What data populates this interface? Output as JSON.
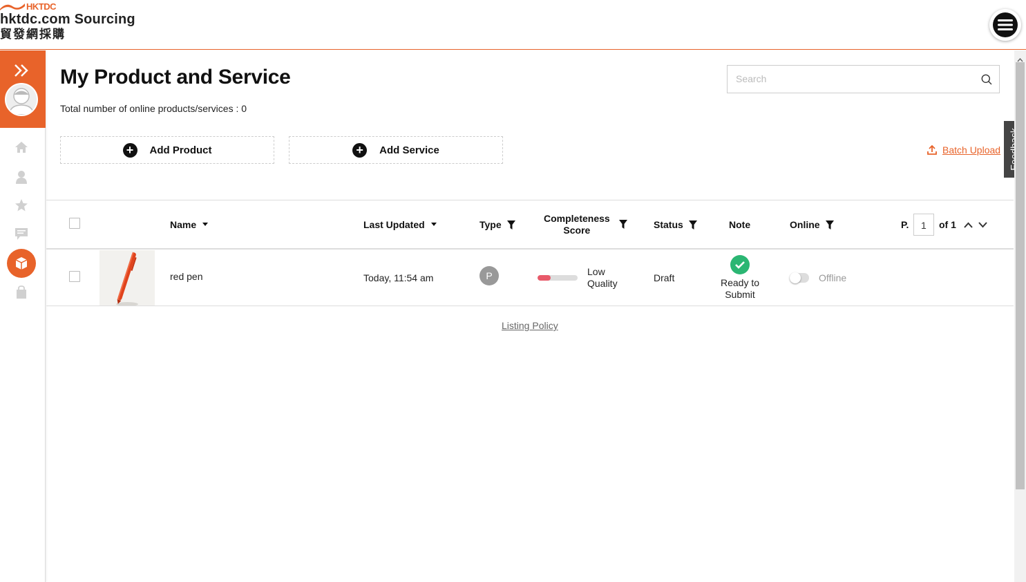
{
  "header": {
    "logo_brand": "HKTDC",
    "logo_title": "hktdc.com Sourcing",
    "logo_cn": "貿發網採購",
    "menu_icon": "hamburger-menu-icon"
  },
  "sidebar": {
    "items": [
      {
        "icon": "home-icon"
      },
      {
        "icon": "user-icon"
      },
      {
        "icon": "star-icon"
      },
      {
        "icon": "message-icon"
      },
      {
        "icon": "box-icon",
        "active": true
      },
      {
        "icon": "bag-icon"
      }
    ]
  },
  "main": {
    "title": "My Product and Service",
    "total_label": "Total number of online products/services : 0",
    "search_placeholder": "Search",
    "add_product_label": "Add Product",
    "add_service_label": "Add Service",
    "batch_upload_label": "Batch Upload",
    "feedback_label": "Feedback",
    "listing_policy_label": "Listing Policy"
  },
  "table": {
    "headers": {
      "name": "Name",
      "last_updated": "Last Updated",
      "type": "Type",
      "completeness_line1": "Completeness",
      "completeness_line2": "Score",
      "status": "Status",
      "note": "Note",
      "online": "Online"
    },
    "pagination": {
      "prefix": "P.",
      "current": "1",
      "suffix": "of 1"
    },
    "rows": [
      {
        "name": "red pen",
        "last_updated": "Today, 11:54 am",
        "type": "P",
        "score_fraction": 0.33,
        "score_line1": "Low",
        "score_line2": "Quality",
        "status": "Draft",
        "note_line1": "Ready to",
        "note_line2": "Submit",
        "online": "Offline"
      }
    ]
  },
  "colors": {
    "accent": "#e8632a",
    "success": "#2bb673",
    "score_low": "#e85a6a"
  }
}
